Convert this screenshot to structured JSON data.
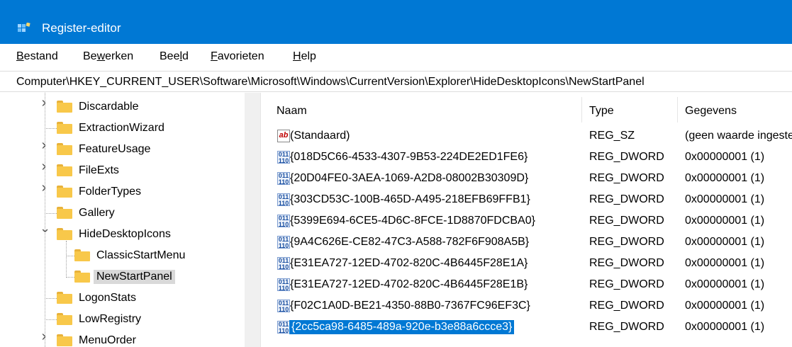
{
  "window": {
    "title": "Register-editor",
    "title_icon": "registry-editor-icon"
  },
  "menu": [
    {
      "label": "Bestand",
      "ul": "B",
      "rest": "estand"
    },
    {
      "label": "Bewerken",
      "pre": "Be",
      "ul": "w",
      "rest": "erken"
    },
    {
      "label": "Beeld",
      "pre": "Bee",
      "ul": "l",
      "rest": "d"
    },
    {
      "label": "Favorieten",
      "ul": "F",
      "rest": "avorieten"
    },
    {
      "label": "Help",
      "ul": "H",
      "rest": "elp"
    }
  ],
  "address": {
    "path": "Computer\\HKEY_CURRENT_USER\\Software\\Microsoft\\Windows\\CurrentVersion\\Explorer\\HideDesktopIcons\\NewStartPanel"
  },
  "tree": {
    "items": [
      {
        "label": "Discardable",
        "expander": "collapsed"
      },
      {
        "label": "ExtractionWizard",
        "expander": "none"
      },
      {
        "label": "FeatureUsage",
        "expander": "collapsed"
      },
      {
        "label": "FileExts",
        "expander": "collapsed"
      },
      {
        "label": "FolderTypes",
        "expander": "collapsed"
      },
      {
        "label": "Gallery",
        "expander": "none"
      },
      {
        "label": "HideDesktopIcons",
        "expander": "expanded"
      },
      {
        "label": "ClassicStartMenu",
        "expander": "none",
        "child": true
      },
      {
        "label": "NewStartPanel",
        "expander": "none",
        "child": true,
        "selected": true
      },
      {
        "label": "LogonStats",
        "expander": "none"
      },
      {
        "label": "LowRegistry",
        "expander": "none"
      },
      {
        "label": "MenuOrder",
        "expander": "collapsed"
      }
    ]
  },
  "list": {
    "columns": {
      "name": "Naam",
      "type": "Type",
      "data": "Gegevens"
    },
    "rows": [
      {
        "name": "(Standaard)",
        "type": "REG_SZ",
        "data": "(geen waarde ingesteld)",
        "icon": "sz"
      },
      {
        "name": "{018D5C66-4533-4307-9B53-224DE2ED1FE6}",
        "type": "REG_DWORD",
        "data": "0x00000001 (1)",
        "icon": "dw"
      },
      {
        "name": "{20D04FE0-3AEA-1069-A2D8-08002B30309D}",
        "type": "REG_DWORD",
        "data": "0x00000001 (1)",
        "icon": "dw"
      },
      {
        "name": "{303CD53C-100B-465D-A495-218EFB69FFB1}",
        "type": "REG_DWORD",
        "data": "0x00000001 (1)",
        "icon": "dw"
      },
      {
        "name": "{5399E694-6CE5-4D6C-8FCE-1D8870FDCBA0}",
        "type": "REG_DWORD",
        "data": "0x00000001 (1)",
        "icon": "dw"
      },
      {
        "name": "{9A4C626E-CE82-47C3-A588-782F6F908A5B}",
        "type": "REG_DWORD",
        "data": "0x00000001 (1)",
        "icon": "dw"
      },
      {
        "name": "{E31EA727-12ED-4702-820C-4B6445F28E1A}",
        "type": "REG_DWORD",
        "data": "0x00000001 (1)",
        "icon": "dw"
      },
      {
        "name": "{E31EA727-12ED-4702-820C-4B6445F28E1B}",
        "type": "REG_DWORD",
        "data": "0x00000001 (1)",
        "icon": "dw"
      },
      {
        "name": "{F02C1A0D-BE21-4350-88B0-7367FC96EF3C}",
        "type": "REG_DWORD",
        "data": "0x00000001 (1)",
        "icon": "dw"
      },
      {
        "name": "{2cc5ca98-6485-489a-920e-b3e88a6ccce3}",
        "type": "REG_DWORD",
        "data": "0x00000001 (1)",
        "icon": "dw",
        "selected": true
      }
    ]
  },
  "colors": {
    "titlebar": "#0078d4",
    "selection": "#0078d4",
    "folder": "#f8c84a"
  }
}
